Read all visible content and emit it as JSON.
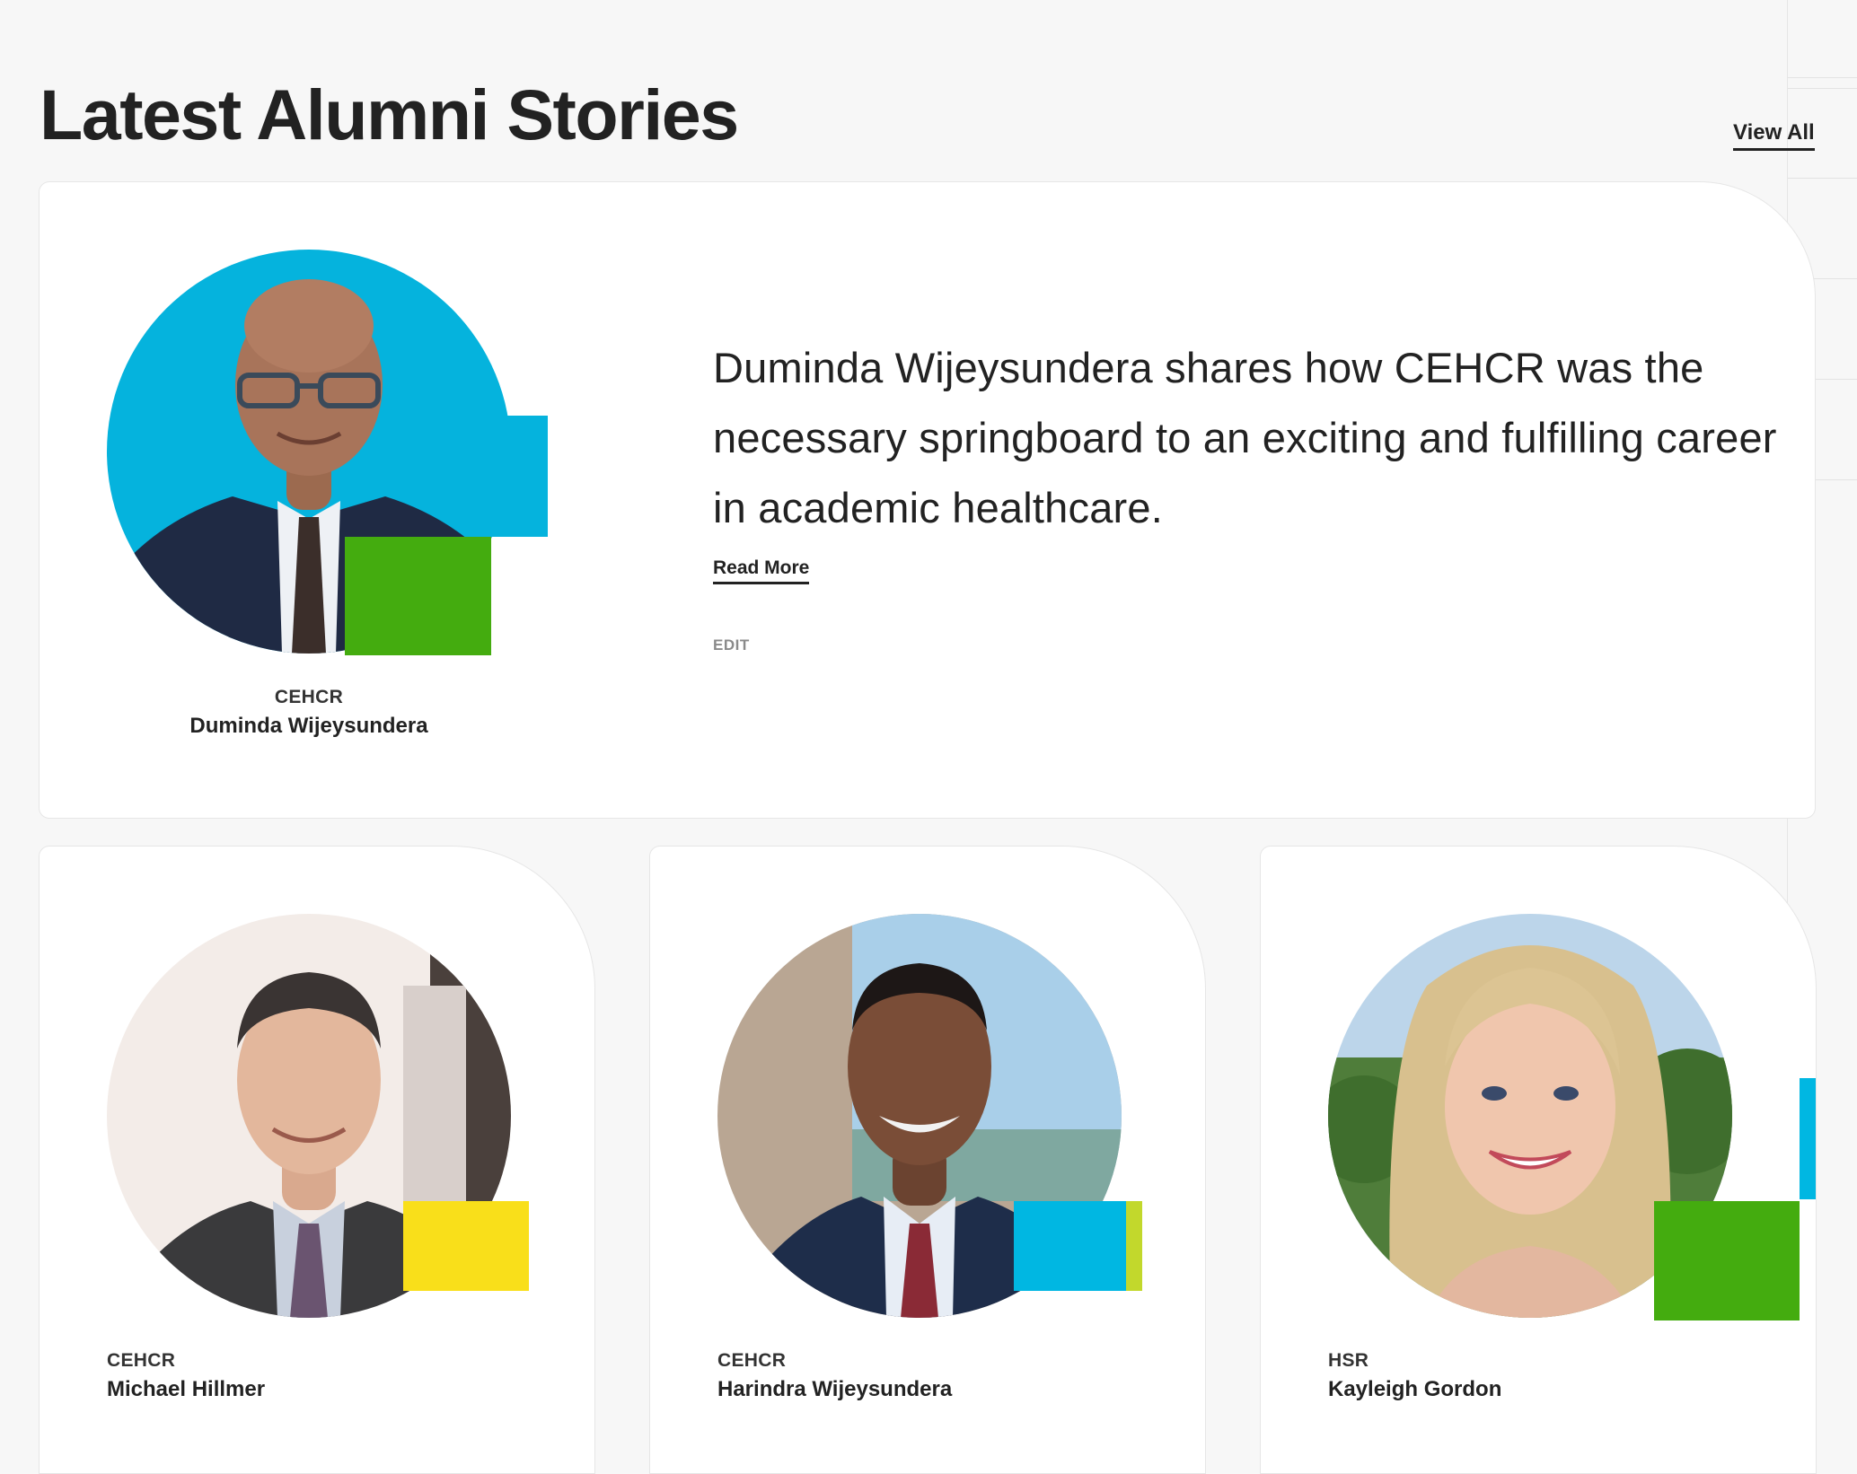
{
  "section": {
    "title": "Latest Alumni Stories",
    "view_all_label": "View All"
  },
  "featured": {
    "category": "CEHCR",
    "name": "Duminda Wijeysundera",
    "quote": "Duminda Wijeysundera shares how CEHCR was the necessary springboard to an exciting and fulfilling career in academic healthcare.",
    "read_more_label": "Read More",
    "edit_label": "EDIT",
    "photo_bg": "#05b3dd",
    "accent_colors": [
      "#05b3dd",
      "#44ac0f"
    ]
  },
  "stories": [
    {
      "category": "CEHCR",
      "name": "Michael Hillmer",
      "accent_colors": [
        "#f9df1a"
      ]
    },
    {
      "category": "CEHCR",
      "name": "Harindra Wijeysundera",
      "accent_colors": [
        "#00b7e2",
        "#c2d82c"
      ]
    },
    {
      "category": "HSR",
      "name": "Kayleigh Gordon",
      "accent_colors": [
        "#00b7e2",
        "#44ac0f"
      ]
    }
  ]
}
